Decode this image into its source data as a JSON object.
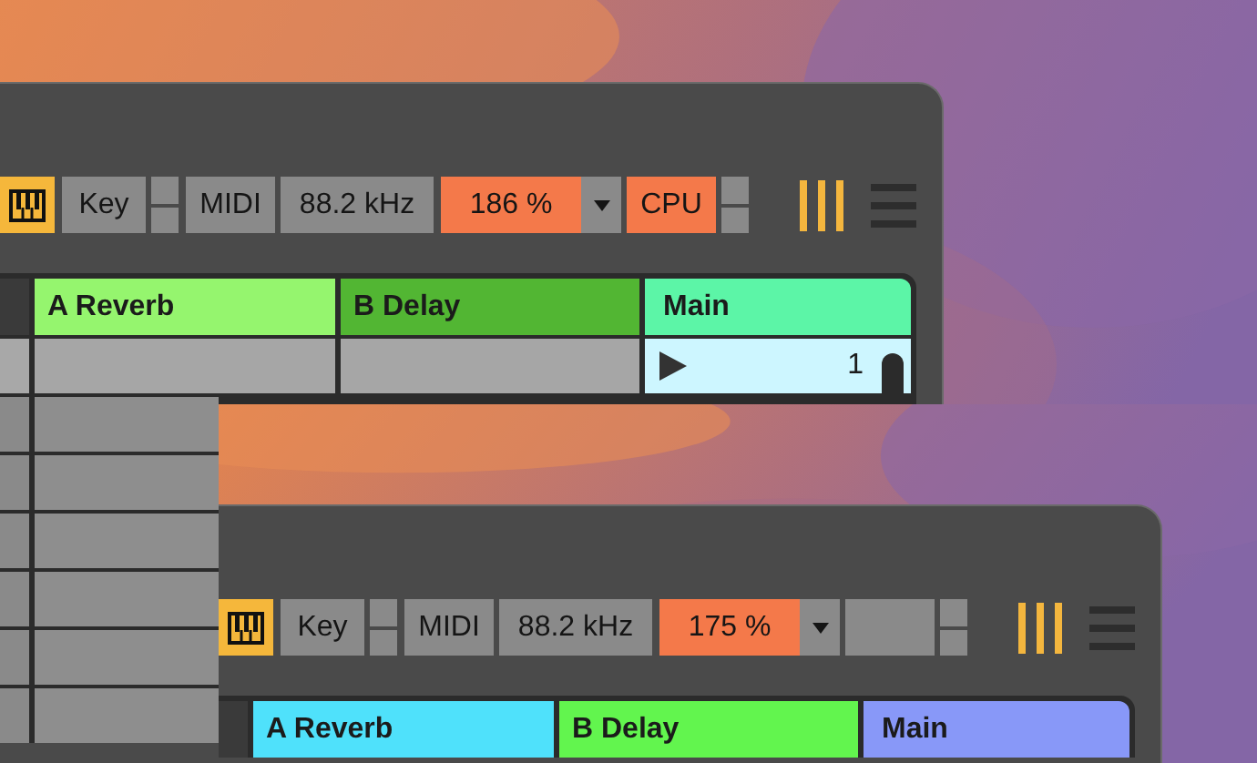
{
  "windows": [
    {
      "toolbar": {
        "key": "Key",
        "midi": "MIDI",
        "sample_rate": "88.2 kHz",
        "zoom": "186 %",
        "cpu": {
          "label": "CPU",
          "warning": true
        }
      },
      "tracks": [
        {
          "name": "A Reverb",
          "color": "#95f56e"
        },
        {
          "name": "B Delay",
          "color": "#52b633"
        },
        {
          "name": "Main",
          "color": "#5cf5a7"
        }
      ],
      "scenes": [
        {
          "selected": true,
          "main_clip": "1"
        },
        {
          "selected": false
        },
        {
          "selected": false
        },
        {
          "selected": false
        },
        {
          "selected": false
        },
        {
          "selected": false
        },
        {
          "selected": false
        }
      ]
    },
    {
      "toolbar": {
        "key": "Key",
        "midi": "MIDI",
        "sample_rate": "88.2 kHz",
        "zoom": "175 %",
        "cpu": {
          "warning": false
        }
      },
      "tracks": [
        {
          "name": "A Reverb",
          "color": "#4fe1fb"
        },
        {
          "name": "B Delay",
          "color": "#62f54e"
        },
        {
          "name": "Main",
          "color": "#8898f8"
        }
      ]
    }
  ]
}
